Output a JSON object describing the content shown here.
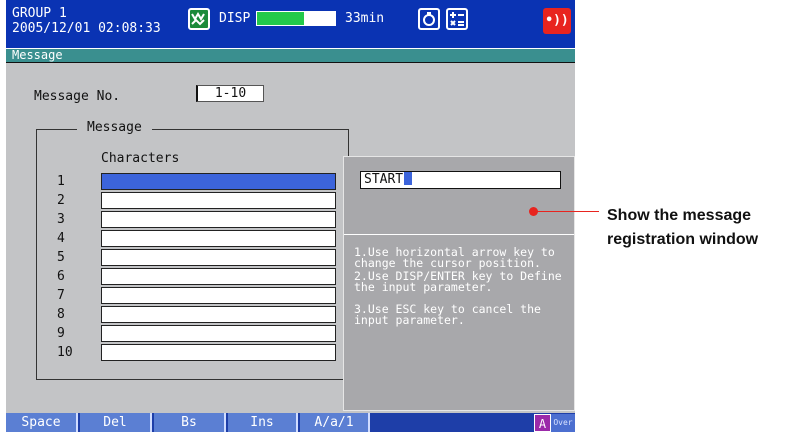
{
  "status_bar": {
    "group": "GROUP 1",
    "datetime": "2005/12/01 02:08:33",
    "disp_label": "DISP",
    "memory_remaining": "33min",
    "memory_fill": 0.6,
    "alarm_symbol": "•))",
    "icons": [
      "display-mode-icon",
      "save-icon",
      "math-icon",
      "alarm-icon"
    ]
  },
  "title": "Message",
  "message_no": {
    "label": "Message No.",
    "value": "1-10"
  },
  "message_group": {
    "legend": "Message",
    "column_header": "Characters",
    "rows": [
      {
        "num": "1",
        "value": "",
        "selected": true
      },
      {
        "num": "2",
        "value": ""
      },
      {
        "num": "3",
        "value": ""
      },
      {
        "num": "4",
        "value": ""
      },
      {
        "num": "5",
        "value": ""
      },
      {
        "num": "6",
        "value": ""
      },
      {
        "num": "7",
        "value": ""
      },
      {
        "num": "8",
        "value": ""
      },
      {
        "num": "9",
        "value": ""
      },
      {
        "num": "10",
        "value": ""
      }
    ]
  },
  "registration_window": {
    "input_value": "START",
    "help": [
      "1.Use horizontal arrow key to change the cursor position.",
      "2.Use DISP/ENTER key to Define the input parameter.",
      "3.Use ESC key to cancel the input parameter."
    ]
  },
  "softkeys": [
    "Space",
    "Del",
    "Bs",
    "Ins",
    "A/a/1"
  ],
  "input_mode": {
    "mode": "A",
    "overwrite": "Over"
  },
  "annotation": {
    "line1": "Show the message",
    "line2": "registration window"
  },
  "colors": {
    "status_bar": "#0a33b3",
    "title_strip": "#3a8f8f",
    "screen_bg": "#c3c4c6",
    "selection": "#3c64db",
    "callout": "#e8241f"
  }
}
